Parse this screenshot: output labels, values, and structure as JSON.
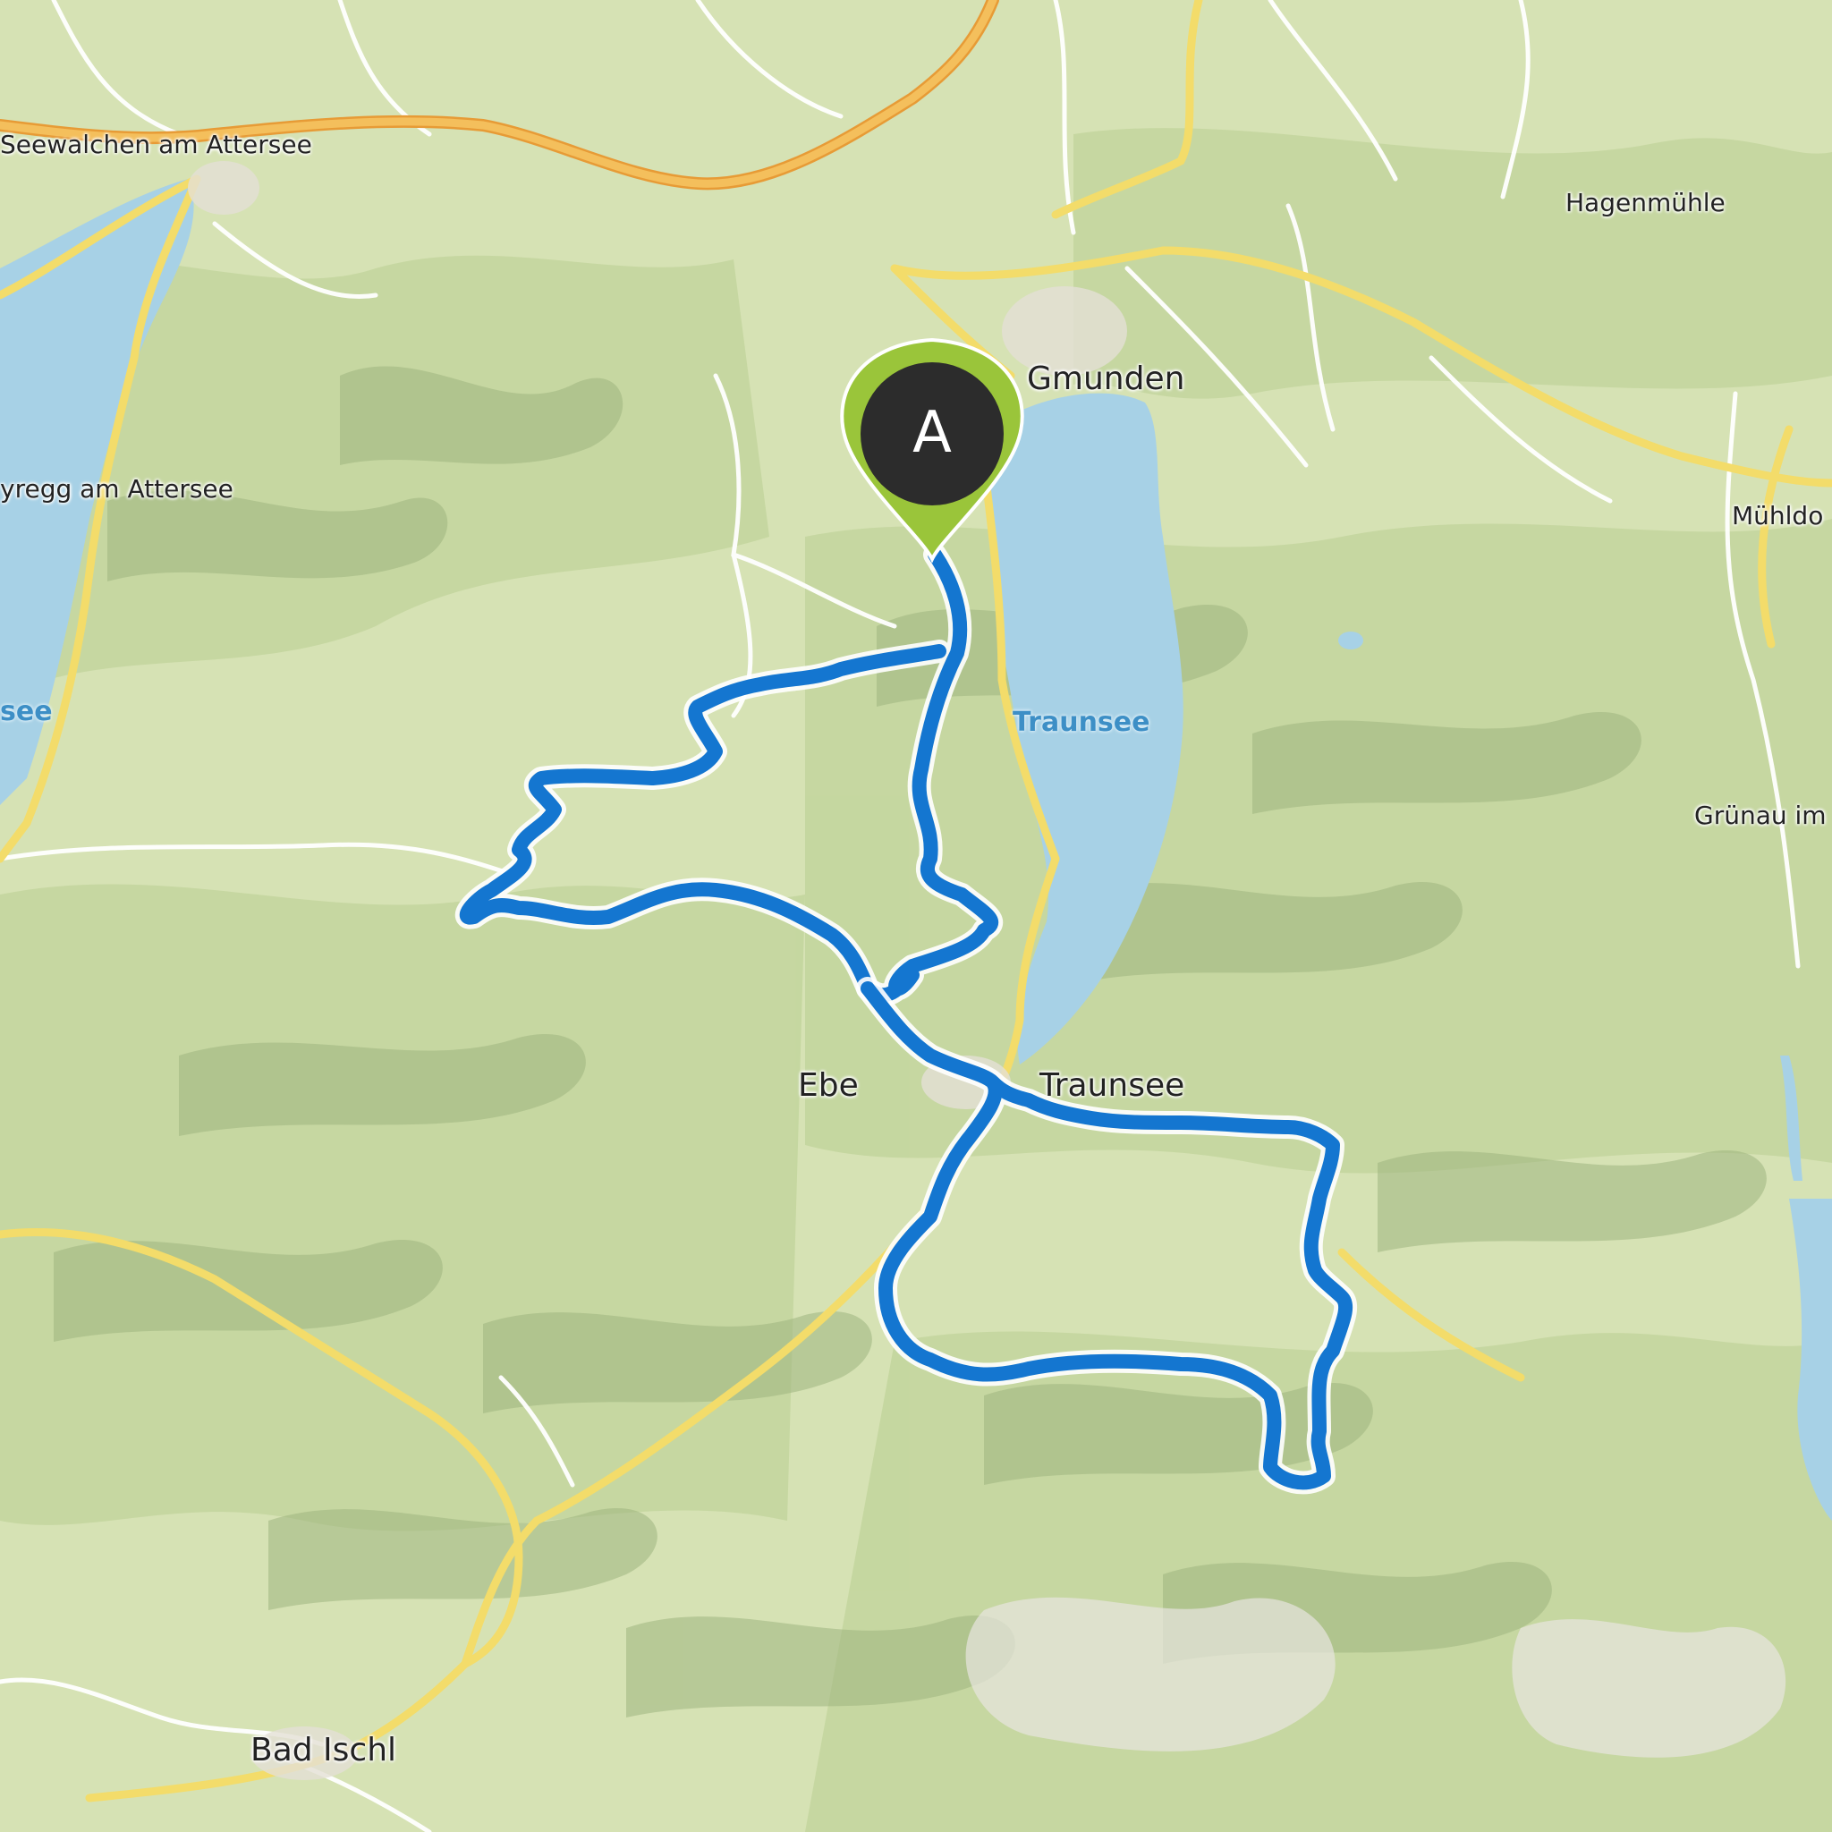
{
  "map": {
    "colors": {
      "land": "#d6e2b4",
      "forest": "#bfd397",
      "hills": "#9bb27a",
      "water": "#a7d1e6",
      "motorway": "#f1b64c",
      "primary_road": "#f3dc6a",
      "minor_road": "#ffffff",
      "route": "#1476d0",
      "marker_pin": "#9ac53a",
      "marker_head": "#2c2c2c"
    },
    "places": {
      "seewalchen": "Seewalchen am Attersee",
      "hagenmuehle": "Hagenmühle",
      "gmunden": "Gmunden",
      "weyregg": "yregg am Attersee",
      "muehldorf": "Mühldo",
      "attersee_fragment": "see",
      "traunsee_lake": "Traunsee",
      "gruenau": "Grünau im",
      "ebensee_fragment": "Ebe",
      "traunsee_town_fragment": "Traunsee",
      "bad_ischl": "Bad Ischl"
    },
    "marker": {
      "letter": "A",
      "icon": "map-pin-icon"
    }
  }
}
